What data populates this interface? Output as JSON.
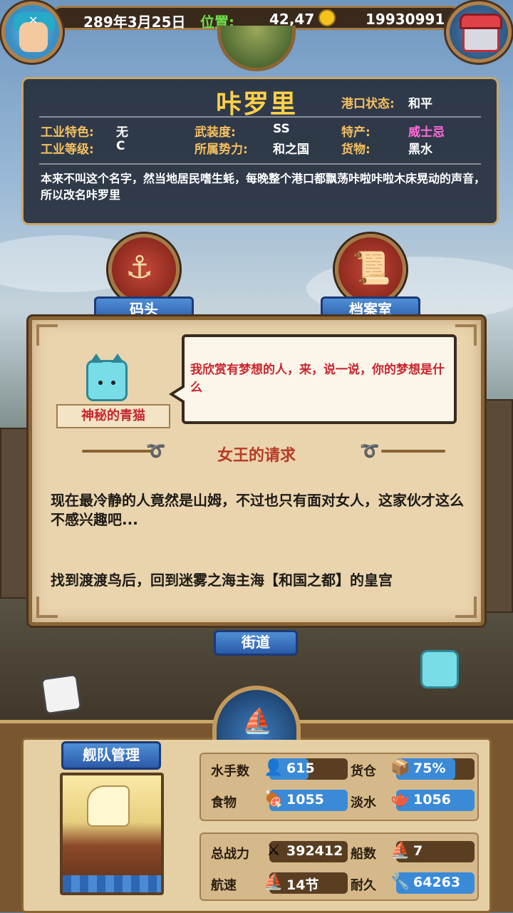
{
  "header": {
    "date": "289年3月25日",
    "position_label": "位置:",
    "position_value": "42,47",
    "gold": "19930991"
  },
  "port": {
    "name": "咔罗里",
    "status_label": "港口状态:",
    "status_value": "和平",
    "attributes": [
      {
        "label": "工业特色:",
        "value": "无"
      },
      {
        "label": "武装度:",
        "value": "SS"
      },
      {
        "label": "特产:",
        "value": "威士忌"
      },
      {
        "label": "工业等级:",
        "value": "C"
      },
      {
        "label": "所属势力:",
        "value": "和之国"
      },
      {
        "label": "货物:",
        "value": "黑水"
      }
    ],
    "description": "本来不叫这个名字，然当地居民嗜生蚝，每晚整个港口都飘荡咔啦咔啦木床晃动的声音，所以改名咔罗里"
  },
  "menu": {
    "dock": "码头",
    "archive": "档案室",
    "street": "街道"
  },
  "dialog": {
    "npc_name": "神秘的青猫",
    "speech": "我欣赏有梦想的人，来，说一说，你的梦想是什么",
    "quest_title": "女王的请求",
    "quest_text": "现在最冷静的人竟然是山姆，不过也只有面对女人，这家伙才这么不感兴趣吧...",
    "quest_goal": "找到渡渡鸟后，回到迷雾之海主海【和国之都】的皇宫"
  },
  "fleet": {
    "title": "舰队管理",
    "stats": [
      {
        "label": "水手数",
        "value": "615",
        "fill": 1.0
      },
      {
        "label": "货仓",
        "value": "75%",
        "fill": 0.75
      },
      {
        "label": "食物",
        "value": "1055",
        "fill": 1.0
      },
      {
        "label": "淡水",
        "value": "1056",
        "fill": 1.0
      },
      {
        "label": "总战力",
        "value": "392412",
        "fill": 1.0
      },
      {
        "label": "船数",
        "value": "7",
        "fill": 1.0
      },
      {
        "label": "航速",
        "value": "14节",
        "fill": 1.0
      },
      {
        "label": "耐久",
        "value": "64263",
        "fill": 1.0
      }
    ]
  },
  "colors": {
    "accent_gold": "#ffd04a",
    "label_gold": "#f4c060",
    "specialty_pink": "#ff6ad8",
    "speech_red": "#c8262e",
    "ribbon_blue": "#2b5aa8"
  }
}
